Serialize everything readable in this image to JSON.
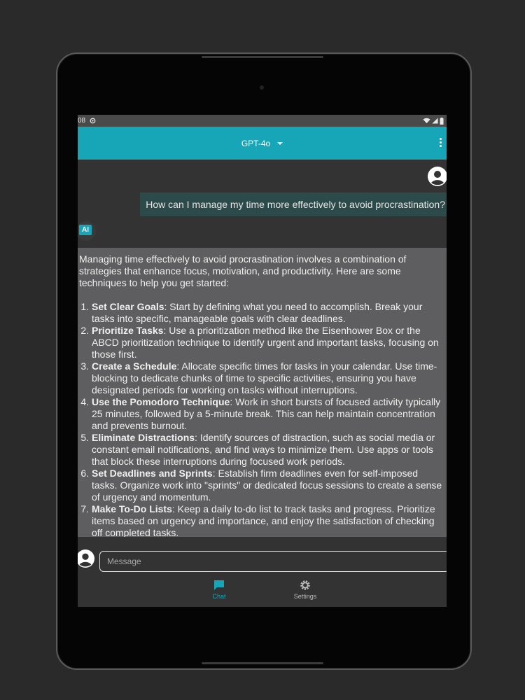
{
  "status": {
    "time_fragment": "08"
  },
  "appbar": {
    "model": "GPT-4o"
  },
  "chat": {
    "user_message": "How can I manage my time more effectively to avoid procrastination?",
    "ai_label": "AI",
    "ai_intro": "Managing time effectively to avoid procrastination involves a combination of strategies that enhance focus, motivation, and productivity. Here are some techniques to help you get started:",
    "ai_items": [
      {
        "title": "Set Clear Goals",
        "text": ": Start by defining what you need to accomplish. Break your tasks into specific, manageable goals with clear deadlines."
      },
      {
        "title": "Prioritize Tasks",
        "text": ": Use a prioritization method like the Eisenhower Box or the ABCD prioritization technique to identify urgent and important tasks, focusing on those first."
      },
      {
        "title": "Create a Schedule",
        "text": ": Allocate specific times for tasks in your calendar. Use time-blocking to dedicate chunks of time to specific activities, ensuring you have designated periods for working on tasks without interruptions."
      },
      {
        "title": "Use the Pomodoro Technique",
        "text": ": Work in short bursts of focused activity typically 25 minutes, followed by a 5-minute break. This can help maintain concentration and prevents burnout."
      },
      {
        "title": "Eliminate Distractions",
        "text": ": Identify sources of distraction, such as social media or constant email notifications, and find ways to minimize them. Use apps or tools that block these interruptions during focused work periods."
      },
      {
        "title": "Set Deadlines and Sprints",
        "text": ": Establish firm deadlines even for self-imposed tasks. Organize work into \"sprints\" or dedicated focus sessions to create a sense of urgency and momentum."
      },
      {
        "title": "Make To-Do Lists",
        "text": ": Keep a daily to-do list to track tasks and progress. Prioritize items based on urgency and importance, and enjoy the satisfaction of checking off completed tasks."
      }
    ]
  },
  "composer": {
    "placeholder": "Message"
  },
  "nav": {
    "chat_label": "Chat",
    "settings_label": "Settings"
  },
  "colors": {
    "accent": "#17a5b8",
    "ai_bubble": "#5e5d5f",
    "user_bubble": "#2d4a4a"
  }
}
